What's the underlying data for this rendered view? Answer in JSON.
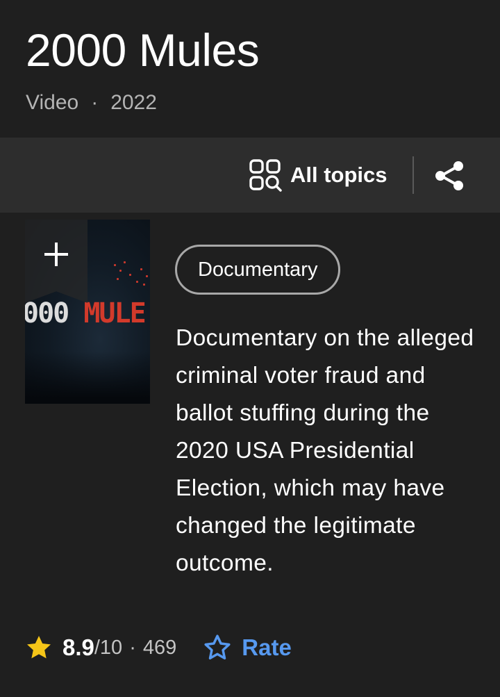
{
  "header": {
    "title": "2000 Mules",
    "type": "Video",
    "year": "2022",
    "separator": "·"
  },
  "toolbar": {
    "all_topics_label": "All topics",
    "all_topics_icon": "topics-grid-search-icon",
    "share_icon": "share-icon"
  },
  "poster": {
    "title_num": "000",
    "title_word": "MULE",
    "watchlist_icon": "plus-icon"
  },
  "genre": {
    "label": "Documentary"
  },
  "plot": {
    "text": "Documentary on the alleged criminal voter fraud and ballot stuffing during the 2020 USA Presidential Election, which may have changed the legitimate outcome."
  },
  "rating": {
    "value": "8.9",
    "scale": "/10",
    "separator": "·",
    "count": "469",
    "rate_label": "Rate",
    "star_icon": "star-filled-icon",
    "rate_icon": "star-outline-icon"
  },
  "colors": {
    "background": "#1f1f1f",
    "toolbar": "#2d2d2d",
    "accent_blue": "#5799ef",
    "star_yellow": "#f5c518",
    "poster_red": "#d23a2b"
  }
}
